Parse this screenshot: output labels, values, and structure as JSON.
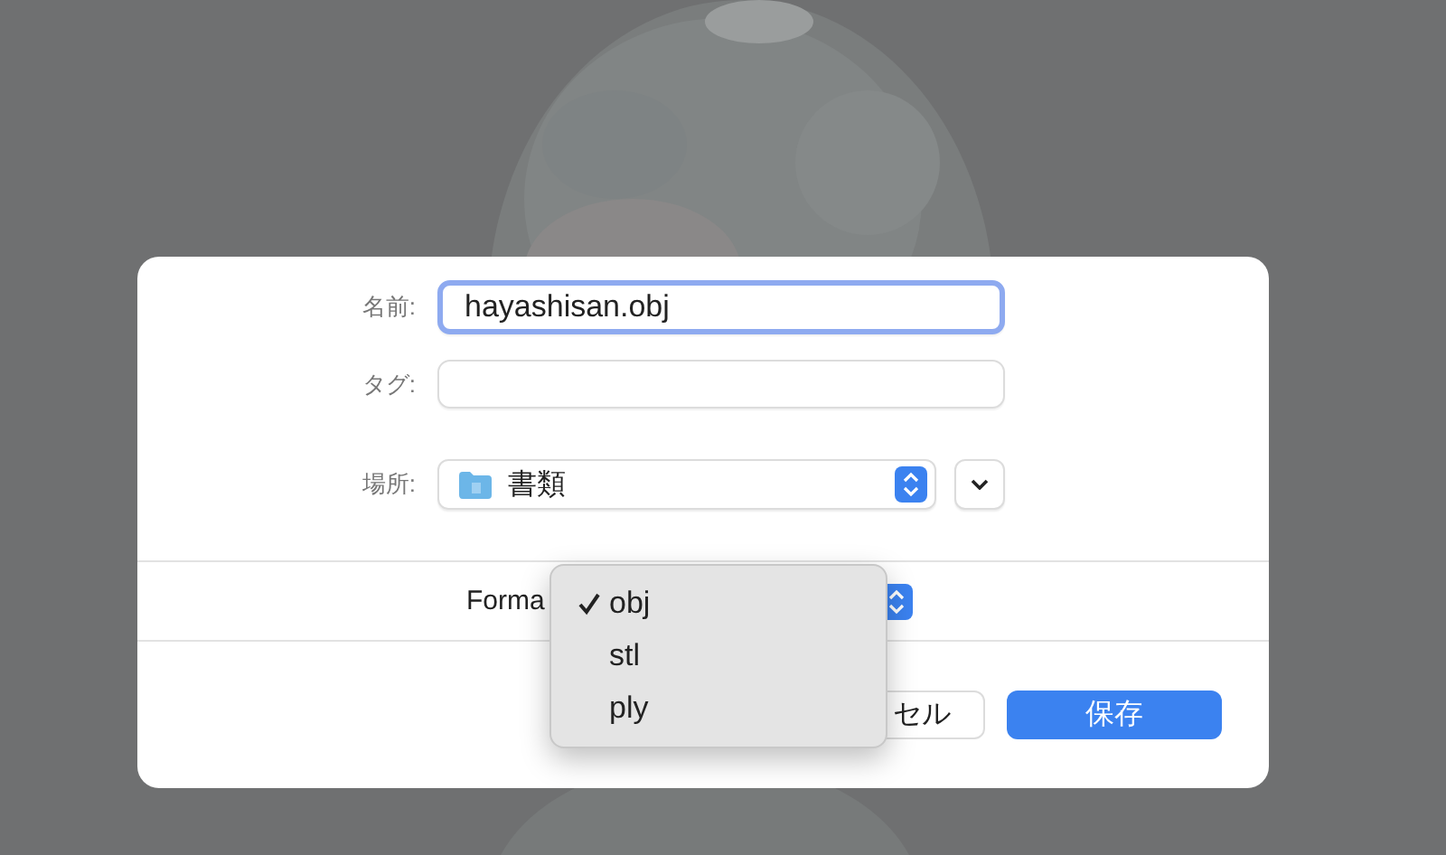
{
  "dialog": {
    "name_label": "名前:",
    "name_value": "hayashisan.obj",
    "name_focused": true,
    "tags_label": "タグ:",
    "location_label": "場所:",
    "location_value": "書類",
    "format_label": "Forma",
    "format_menu": [
      {
        "label": "obj",
        "selected": true
      },
      {
        "label": "stl",
        "selected": false
      },
      {
        "label": "ply",
        "selected": false
      }
    ],
    "buttons": [
      {
        "label": "セル",
        "kind": "cancel"
      },
      {
        "label": "保存",
        "kind": "default"
      }
    ]
  }
}
